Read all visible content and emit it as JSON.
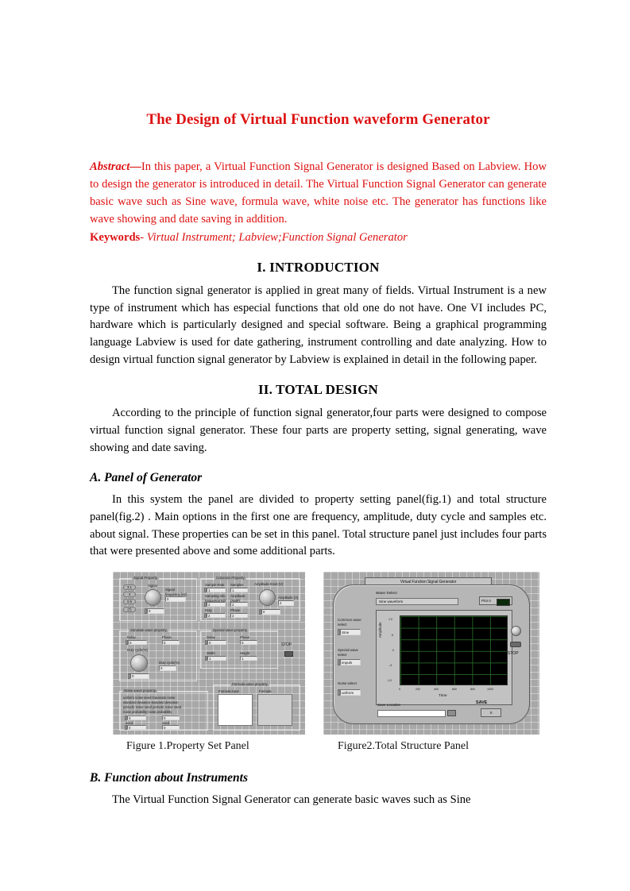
{
  "document": {
    "title": "The Design of Virtual Function waveform Generator",
    "title_color": "#dd1111",
    "abstract": {
      "lead": "Abstract—",
      "body": "In this paper, a Virtual Function Signal Generator is designed Based on Labview. How to design the generator is introduced in detail. The Virtual Function Signal Generator can generate basic wave such as Sine wave, formula wave, white noise etc. The generator has functions like wave showing and date saving in addition.",
      "keywords_lead": "Keywords",
      "keywords_sep": "- ",
      "keywords_body": "Virtual Instrument; Labview;Function Signal Generator"
    },
    "sections": [
      {
        "heading": "I. INTRODUCTION",
        "paragraph": "The function signal generator is applied in great many of fields. Virtual Instrument is a new type of instrument which has especial functions that old one do not have. One VI includes PC, hardware which is particularly designed and special software. Being a graphical programming language Labview is used for date gathering, instrument controlling and date analyzing. How to design virtual function signal generator by Labview is explained in detail in the following paper."
      },
      {
        "heading": "II. TOTAL DESIGN",
        "paragraph": "According to the principle of function signal generator,four parts were designed to compose virtual function signal generator. These four parts are property setting, signal generating, wave showing and date saving."
      }
    ],
    "subsection_a": {
      "heading": "A. Panel of Generator",
      "paragraph": "In this system the panel are divided to property setting panel(fig.1) and total structure panel(fig.2) . Main options in the first one are frequency, amplitude, duty cycle and samples etc. about signal. These properties can be set in this panel. Total structure panel just includes four parts that were presented above and some additional parts."
    },
    "subsection_b": {
      "heading": "B. Function about Instruments",
      "paragraph": "The Virtual Function Signal Generator can generate basic waves such as Sine"
    },
    "figures": [
      {
        "caption": "Figure 1.Property Set Panel"
      },
      {
        "caption": "Figure2.Total Structure Panel"
      }
    ]
  },
  "figure1": {
    "groups": [
      {
        "label": "Signal Property"
      },
      {
        "label": "Common Property"
      },
      {
        "label": "Simulate wave property"
      },
      {
        "label": "Special wave property"
      },
      {
        "label": "Noise wave property"
      },
      {
        "label": "Formula wave property"
      }
    ],
    "signal_property": {
      "pills": [
        "3.1",
        "4",
        "0.5",
        "(7)"
      ],
      "knob_label": "Signal",
      "knob_ticks": [
        "4",
        "6",
        "2",
        "8",
        "1",
        "12"
      ],
      "field_label": "Signal\nfrequency (Hz)",
      "field_value": "0",
      "dial_value": "0"
    },
    "common_property": {
      "fields": [
        {
          "label": "Sample Rate",
          "value": "1"
        },
        {
          "label": "Samples",
          "value": "1"
        },
        {
          "label": "Sampling info\nfrequency(Hz)",
          "value": "2"
        },
        {
          "label": "Amplitude\n(AMP)",
          "value": "2"
        },
        {
          "label": "Duty",
          "value": "2"
        },
        {
          "label": "Phase",
          "value": "2"
        }
      ],
      "knob_label": "Amplitude Knob (V)",
      "knob_ticks": [
        "4",
        "6",
        "2",
        "8",
        "0",
        "A"
      ],
      "side_field_label": "Amplitude (V)",
      "side_field_value": "2",
      "bottom_value": "0"
    },
    "simulate_property": {
      "fields": [
        {
          "label": "Delay",
          "value": "0"
        },
        {
          "label": "Phase",
          "value": "0"
        }
      ],
      "knob_label": "Duty cycle(%)",
      "knob_ticks": [
        "40",
        "50",
        "60",
        "30",
        "70",
        "20",
        "80",
        "10",
        "90"
      ],
      "out_label": "Duty cycle(%)",
      "out_value": "0",
      "dial_value": "0"
    },
    "special_property": {
      "fields": [
        {
          "label": "Delay",
          "value": "0"
        },
        {
          "label": "Phase",
          "value": "0"
        },
        {
          "label": "Width",
          "value": "1"
        },
        {
          "label": "Height",
          "value": "1"
        }
      ]
    },
    "noise_property": {
      "lines": [
        "uniform noise seed     Gaussian noise",
        "standard deviation       standard deviation",
        "periodic noise seed    periodic noise seed",
        "noise probability         noise probability"
      ],
      "fields": [
        {
          "value": "0"
        },
        {
          "value": "0"
        },
        {
          "value": "0"
        },
        {
          "value": "0"
        }
      ],
      "seed_labels": [
        "seed",
        "seed"
      ]
    },
    "formula_property": {
      "labels": [
        "Formula input",
        "Formula"
      ]
    },
    "misc_label": "STOP"
  },
  "figure2": {
    "window_title": "Virtual Function Signal Generator",
    "wave_select": {
      "caption": "Wave Select",
      "value": "Sine waveform"
    },
    "led": {
      "label": "Plot 0"
    },
    "left_controls": [
      {
        "label": "Common wave\nselect",
        "value": "Sine"
      },
      {
        "label": "Special wave\nselect",
        "value": "impuls"
      },
      {
        "label": "Noise select",
        "value": "uniform"
      }
    ],
    "graph": {
      "x_label": "Time",
      "y_label": "Amplitude",
      "x_ticks": [
        "0",
        "200",
        "400",
        "600",
        "800",
        "1000"
      ],
      "y_ticks": [
        "1.0",
        ".5",
        "0",
        "-.5",
        "-1.0"
      ]
    },
    "save": {
      "caption": "Save Location",
      "value": "",
      "title": "SAVE",
      "button_label": "S"
    },
    "stop_label": "STOP"
  },
  "chart_data": {
    "type": "line",
    "title": "Virtual Function Signal Generator waveform display",
    "xlabel": "Time",
    "ylabel": "Amplitude",
    "x_ticks": [
      0,
      200,
      400,
      600,
      800,
      1000
    ],
    "y_ticks": [
      1.0,
      0.5,
      0,
      -0.5,
      -1.0
    ],
    "xlim": [
      0,
      1000
    ],
    "ylim": [
      -1.0,
      1.0
    ],
    "grid": true,
    "legend": "Plot 0",
    "series": [
      {
        "name": "Plot 0",
        "values": []
      }
    ],
    "note": "Graph canvas is empty (black) in the screenshot - no waveform trace plotted."
  }
}
